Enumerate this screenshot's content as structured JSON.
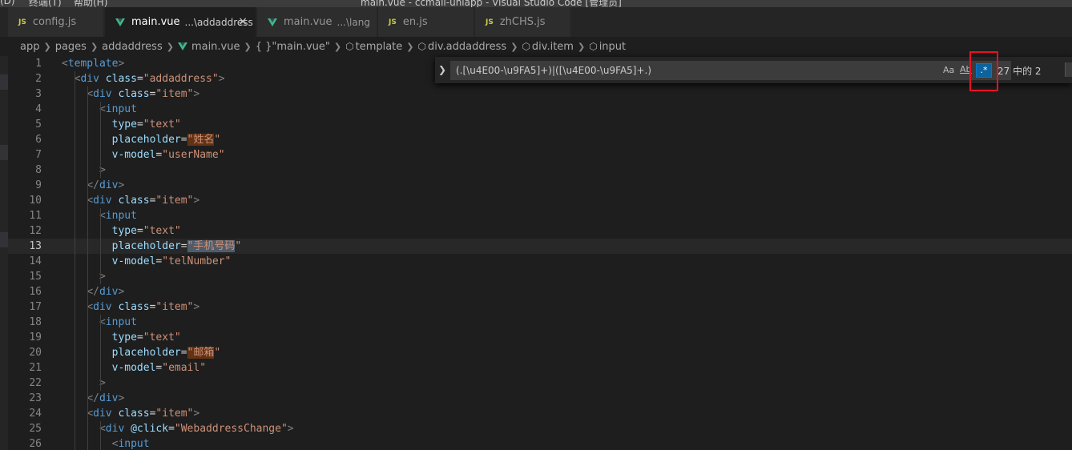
{
  "titlebar": {
    "menus": [
      "(D)",
      "终端(T)",
      "帮助(H)"
    ],
    "window_title": "main.vue - ccmall-uniapp - Visual Studio Code [管理员]"
  },
  "tabs": [
    {
      "icon": "JS",
      "label": "config.js",
      "desc": ""
    },
    {
      "icon": "vue",
      "label": "main.vue",
      "desc": "...\\addaddress",
      "active": true
    },
    {
      "icon": "vue",
      "label": "main.vue",
      "desc": "...\\lang"
    },
    {
      "icon": "JS",
      "label": "en.js",
      "desc": ""
    },
    {
      "icon": "JS",
      "label": "zhCHS.js",
      "desc": ""
    }
  ],
  "breadcrumb": {
    "items": [
      "app",
      "pages",
      "addaddress",
      "main.vue",
      "{ }\"main.vue\"",
      "template",
      "div.addaddress",
      "div.item",
      "input"
    ]
  },
  "find": {
    "query": "(.[\\u4E00-\\u9FA5]+)|([\\u4E00-\\u9FA5]+.)",
    "match_case": "Aa",
    "whole_word": "Ab",
    "regex": ".*",
    "regex_enabled": true,
    "count": "27 中的 2"
  },
  "editor": {
    "current_line": 13,
    "lines": [
      {
        "n": "1",
        "text": "<template>"
      },
      {
        "n": "2",
        "text": "  <div class=\"addaddress\">"
      },
      {
        "n": "3",
        "text": "    <div class=\"item\">"
      },
      {
        "n": "4",
        "text": "      <input"
      },
      {
        "n": "5",
        "text": "        type=\"text\""
      },
      {
        "n": "6",
        "text": "        placeholder=\"姓名\""
      },
      {
        "n": "7",
        "text": "        v-model=\"userName\""
      },
      {
        "n": "8",
        "text": "      >"
      },
      {
        "n": "9",
        "text": "    </div>"
      },
      {
        "n": "10",
        "text": "    <div class=\"item\">"
      },
      {
        "n": "11",
        "text": "      <input"
      },
      {
        "n": "12",
        "text": "        type=\"text\""
      },
      {
        "n": "13",
        "text": "        placeholder=\"手机号码\""
      },
      {
        "n": "14",
        "text": "        v-model=\"telNumber\""
      },
      {
        "n": "15",
        "text": "      >"
      },
      {
        "n": "16",
        "text": "    </div>"
      },
      {
        "n": "17",
        "text": "    <div class=\"item\">"
      },
      {
        "n": "18",
        "text": "      <input"
      },
      {
        "n": "19",
        "text": "        type=\"text\""
      },
      {
        "n": "20",
        "text": "        placeholder=\"邮箱\""
      },
      {
        "n": "21",
        "text": "        v-model=\"email\""
      },
      {
        "n": "22",
        "text": "      >"
      },
      {
        "n": "23",
        "text": "    </div>"
      },
      {
        "n": "24",
        "text": "    <div class=\"item\">"
      },
      {
        "n": "25",
        "text": "      <div @click=\"WebaddressChange\">"
      },
      {
        "n": "26",
        "text": "        <input"
      }
    ]
  },
  "colors": {
    "editor_bg": "#1e1e1e",
    "tag": "#569cd6",
    "attr": "#9cdcfe",
    "string": "#ce9178",
    "match_highlight": "#613214",
    "current_match": "#515c6a",
    "regex_toggle": "#0e639c",
    "annotation_box": "#e81123"
  }
}
